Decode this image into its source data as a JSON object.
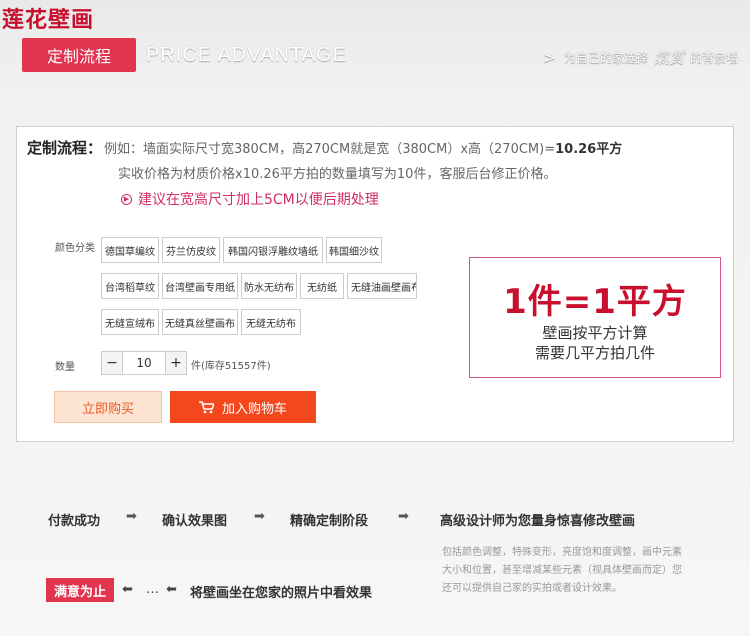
{
  "brand": "莲花壁画",
  "header": {
    "badge": "定制流程",
    "title_en": "PRICE ADVANTAGE",
    "slogan_prefix": "为自己的家选择",
    "slogan_script": "氣質",
    "slogan_suffix": "的背景墙"
  },
  "intro": {
    "label": "定制流程：",
    "line1_pre": "例如：墙面实际尺寸宽380CM，高270CM就是宽（380CM）x高（270CM)=",
    "line1_strong": "10.26平方",
    "line2": "实收价格为材质价格x10.26平方拍的数量填写为10件，客服后台修正价格。",
    "tip": "建议在宽高尺寸加上5CM以便后期处理"
  },
  "options": {
    "label": "颜色分类",
    "items": [
      "德国草编纹",
      "芬兰仿皮纹",
      "韩国闪银浮雕纹墙纸",
      "韩国细沙纹",
      "台湾稻草纹",
      "台湾壁画专用纸",
      "防水无纺布",
      "无纺纸",
      "无缝油画壁画布",
      "无缝宣绒布",
      "无缝真丝壁画布",
      "无缝无纺布"
    ]
  },
  "quantity": {
    "label": "数量",
    "minus": "−",
    "value": "10",
    "plus": "+",
    "stock": "件(库存51557件)"
  },
  "buttons": {
    "buy_now": "立即购买",
    "add_cart": "加入购物车"
  },
  "info_box": {
    "big": "1件=1平方",
    "line1": "壁画按平方计算",
    "line2": "需要几平方拍几件"
  },
  "process": {
    "steps": [
      "付款成功",
      "确认效果图",
      "精确定制阶段",
      "高级设计师为您量身惊喜修改壁画"
    ],
    "arrow": "➡",
    "desc": "包括颜色调整，特殊变形，亮度饱和度调整，画中元素大小和位置，甚至增减某些元素（视具体壁画而定）您还可以提供自己家的实拍或者设计效果。",
    "satisfied": "满意为止",
    "left_arrow": "⬅",
    "ellipsis": "…",
    "final_step": "将壁画坐在您家的照片中看效果"
  }
}
